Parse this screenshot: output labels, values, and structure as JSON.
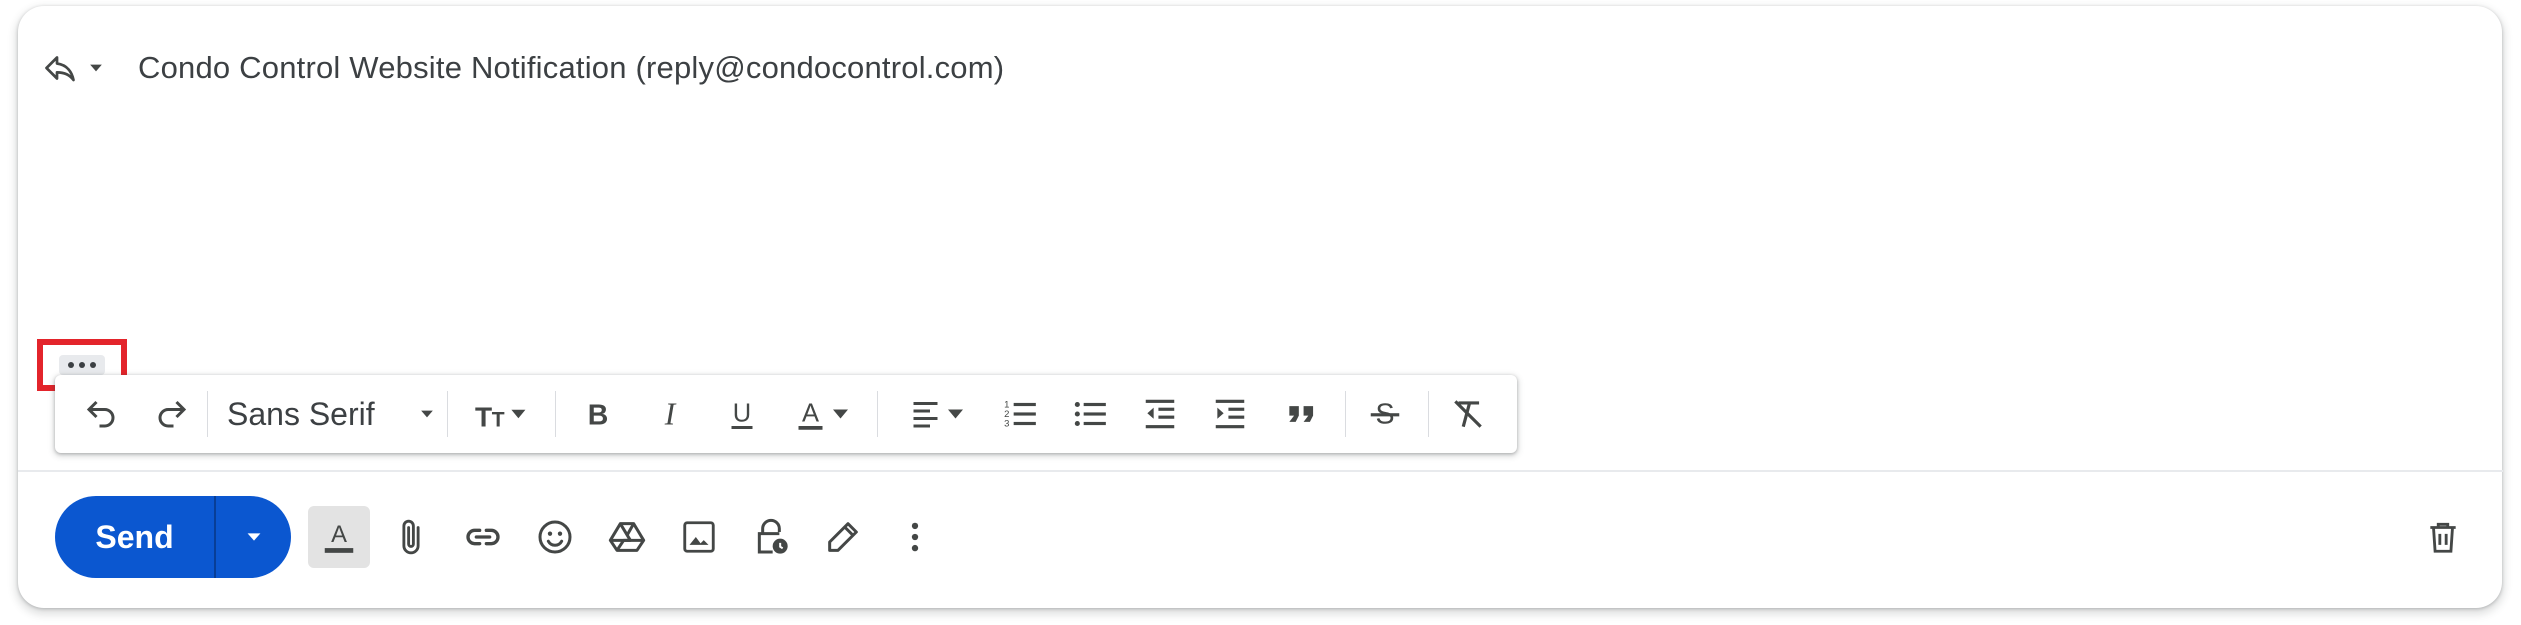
{
  "compose": {
    "recipient": "Condo Control Website Notification (reply@condocontrol.com)"
  },
  "format_toolbar": {
    "font_name": "Sans Serif",
    "buttons": [
      "undo",
      "redo",
      "font",
      "text-size",
      "bold",
      "italic",
      "underline",
      "text-color",
      "align",
      "numbered-list",
      "bulleted-list",
      "indent-less",
      "indent-more",
      "quote",
      "strikethrough",
      "remove-formatting"
    ]
  },
  "bottom_toolbar": {
    "send_label": "Send",
    "icons": [
      "formatting-options-icon",
      "attach-icon",
      "link-icon",
      "emoji-icon",
      "drive-icon",
      "photo-icon",
      "confidential-icon",
      "signature-icon",
      "more-options-icon",
      "trash-icon"
    ]
  },
  "colors": {
    "send_blue": "#0b57d0",
    "icon_gray": "#444746",
    "highlight_red": "#e3242b"
  }
}
